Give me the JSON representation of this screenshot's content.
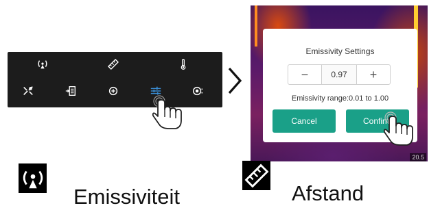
{
  "toolbar": {
    "top_row": [
      "emissivity-icon",
      "distance-icon",
      "thermometer-icon"
    ],
    "bottom_row": [
      "shortcut-icon",
      "export-icon",
      "crosshair-icon",
      "sliders-icon",
      "settings-icon"
    ]
  },
  "dialog": {
    "title": "Emissivity Settings",
    "minus": "−",
    "value": "0.97",
    "plus": "+",
    "range": "Emissivity range:0.01 to 1.00",
    "cancel": "Cancel",
    "confirm": "Confirm"
  },
  "thermal": {
    "temp_readout": "20.5"
  },
  "legend": {
    "emissivity_label": "Emissiviteit",
    "distance_label": "Afstand"
  },
  "colors": {
    "accent": "#1aa088",
    "toolbar_bg": "#1c1c1c",
    "active_icon": "#3a8fd6"
  }
}
